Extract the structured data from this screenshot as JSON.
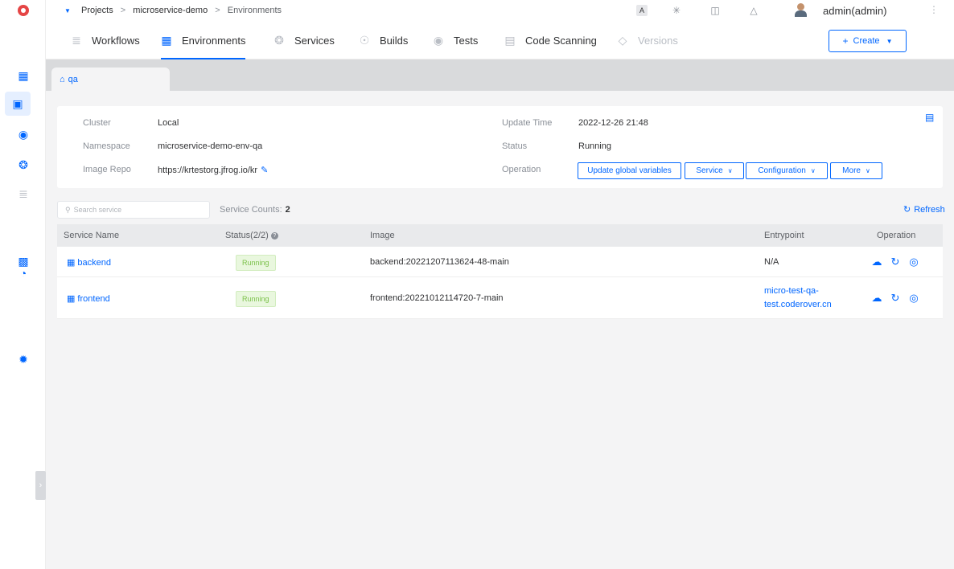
{
  "breadcrumb": {
    "items": [
      "Projects",
      "microservice-demo",
      "Environments"
    ]
  },
  "topbar": {
    "user": "admin(admin)",
    "icon_box_label": "A"
  },
  "tabs": [
    {
      "label": "Workflows",
      "icon": "workflow-icon"
    },
    {
      "label": "Environments",
      "icon": "code-icon",
      "active": true
    },
    {
      "label": "Services",
      "icon": "service-icon"
    },
    {
      "label": "Builds",
      "icon": "build-icon"
    },
    {
      "label": "Tests",
      "icon": "flask-icon"
    },
    {
      "label": "Code Scanning",
      "icon": "scan-icon"
    },
    {
      "label": "Versions",
      "icon": "version-icon",
      "disabled": true
    }
  ],
  "create_label": "Create",
  "env": {
    "tab_label": "qa"
  },
  "info": {
    "cluster_label": "Cluster",
    "cluster": "Local",
    "namespace_label": "Namespace",
    "namespace": "microservice-demo-env-qa",
    "image_repo_label": "Image Repo",
    "image_repo": "https://krtestorg.jfrog.io/kr",
    "update_time_label": "Update Time",
    "update_time": "2022-12-26 21:48",
    "status_label": "Status",
    "status": "Running",
    "operation_label": "Operation"
  },
  "operations": {
    "update_global": "Update global variables",
    "service": "Service",
    "configuration": "Configuration",
    "more": "More"
  },
  "search": {
    "placeholder": "Search service"
  },
  "service_counts": {
    "label": "Service Counts:",
    "value": "2"
  },
  "refresh_label": "Refresh",
  "table": {
    "columns": {
      "name": "Service Name",
      "status": "Status(2/2)",
      "image": "Image",
      "entrypoint": "Entrypoint",
      "operation": "Operation"
    },
    "rows": [
      {
        "name": "backend",
        "status": "Running",
        "image": "backend:20221207113624-48-main",
        "entrypoint": "N/A"
      },
      {
        "name": "frontend",
        "status": "Running",
        "image": "frontend:20221012114720-7-main",
        "entrypoint": "micro-test-qa-test.coderover.cn"
      }
    ]
  },
  "colors": {
    "accent": "#0066ff",
    "running_text": "#7bc14a",
    "running_bg": "#e9f7de",
    "logo": "#e54545"
  }
}
